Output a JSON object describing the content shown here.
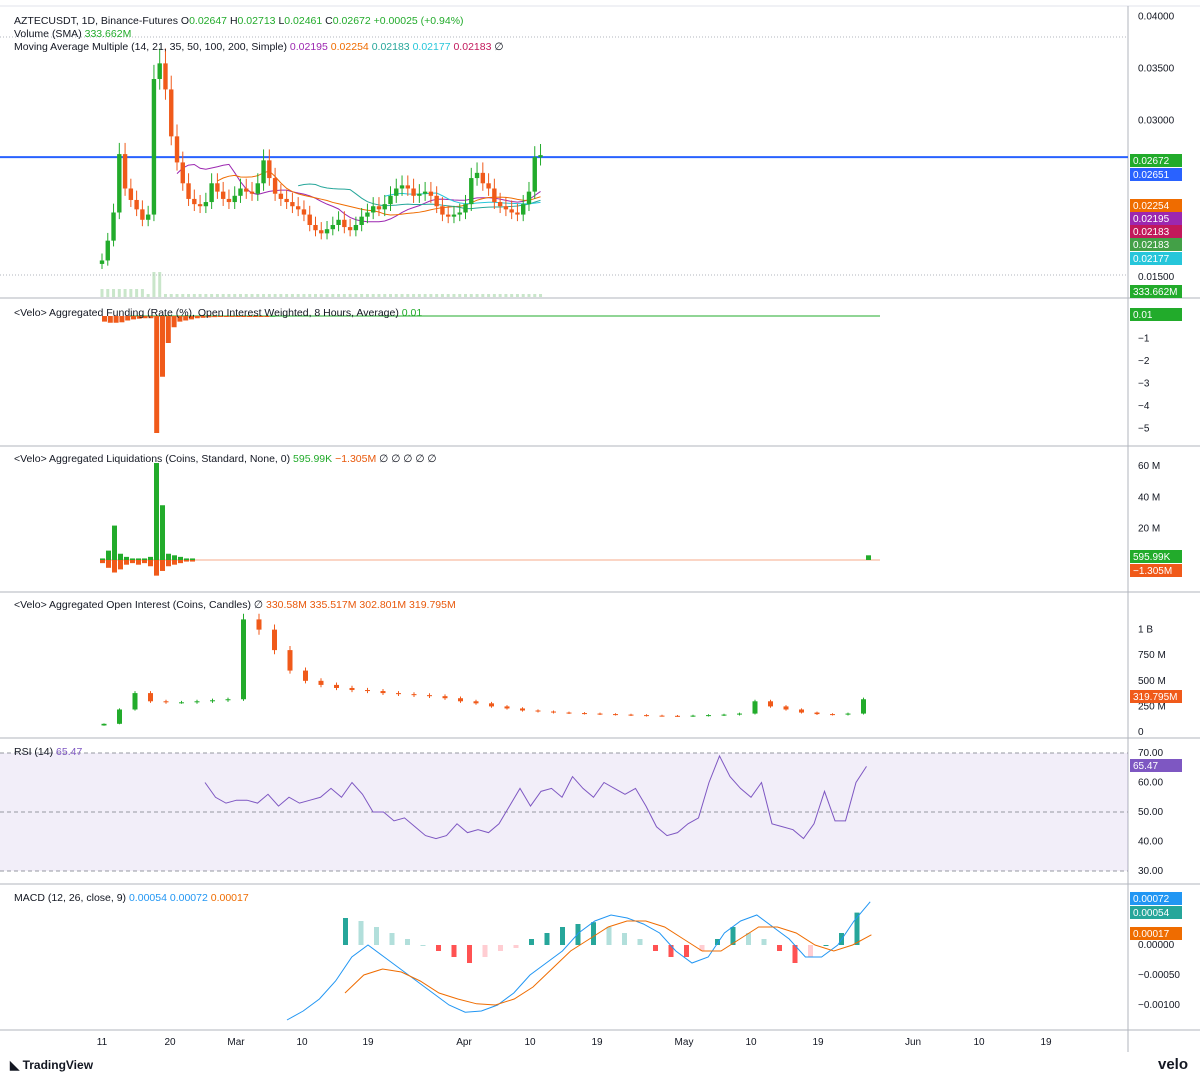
{
  "header": {
    "symbol": "AZTECUSDT, 1D, Binance-Futures",
    "o_label": "O",
    "o": "0.02647",
    "h_label": "H",
    "h": "0.02713",
    "l_label": "L",
    "l": "0.02461",
    "c_label": "C",
    "c": "0.02672",
    "change": "+0.00025 (+0.94%)"
  },
  "volume": {
    "label": "Volume (SMA)",
    "value": "333.662M"
  },
  "ma": {
    "label": "Moving Average Multiple (14, 21, 35, 50, 100, 200, Simple)",
    "v1": "0.02195",
    "v2": "0.02254",
    "v3": "0.02183",
    "v4": "0.02177",
    "v5": "0.02183",
    "null": "∅"
  },
  "funding": {
    "label": "<Velo> Aggregated Funding (Rate (%), Open Interest Weighted, 8 Hours, Average)",
    "value": "0.01"
  },
  "liquidations": {
    "label": "<Velo> Aggregated Liquidations (Coins, Standard, None, 0)",
    "v1": "595.99K",
    "v2": "−1.305M",
    "nulls": "∅ ∅ ∅ ∅ ∅"
  },
  "oi": {
    "label": "<Velo> Aggregated Open Interest (Coins, Candles)",
    "null": "∅",
    "v1": "330.58M",
    "v2": "335.517M",
    "v3": "302.801M",
    "v4": "319.795M"
  },
  "rsi": {
    "label": "RSI (14)",
    "value": "65.47"
  },
  "macd": {
    "label": "MACD (12, 26, close, 9)",
    "v1": "0.00054",
    "v2": "0.00072",
    "v3": "0.00017"
  },
  "branding": {
    "tradingview": "TradingView",
    "velo": "velo"
  },
  "colors": {
    "up": "#22ab2b",
    "down": "#f05a1a",
    "hline": "#2962ff",
    "rsi": "#7e57c2",
    "macd": "#2196f3",
    "signal": "#ef6c00"
  },
  "chart_data": [
    {
      "type": "candlestick",
      "title": "AZTECUSDT, 1D, Binance-Futures",
      "x_ticks": [
        "11",
        "20",
        "Mar",
        "10",
        "19",
        "Apr",
        "10",
        "19",
        "May",
        "10",
        "19",
        "Jun",
        "10",
        "19"
      ],
      "y_ticks": [
        "0.04000",
        "0.03500",
        "0.03000",
        "0.01500"
      ],
      "ylim": [
        0.013,
        0.041
      ],
      "horizontal_line": 0.02651,
      "price_labels": [
        "0.02672",
        "0.02651",
        "0.02254",
        "0.02195",
        "0.02183",
        "0.02183",
        "0.02177",
        "333.662M"
      ],
      "ohlc_close_series": [
        0.0166,
        0.0185,
        0.0212,
        0.0268,
        0.0235,
        0.0224,
        0.0215,
        0.0205,
        0.021,
        0.034,
        0.0355,
        0.033,
        0.0285,
        0.026,
        0.024,
        0.0225,
        0.022,
        0.0218,
        0.0222,
        0.024,
        0.0232,
        0.0225,
        0.0222,
        0.0228,
        0.0235,
        0.0232,
        0.023,
        0.024,
        0.0262,
        0.0245,
        0.023,
        0.0225,
        0.0222,
        0.0218,
        0.0215,
        0.021,
        0.02,
        0.0195,
        0.0192,
        0.0196,
        0.02,
        0.0205,
        0.0198,
        0.0195,
        0.02,
        0.0208,
        0.0212,
        0.0218,
        0.0215,
        0.022,
        0.0228,
        0.0235,
        0.0238,
        0.0235,
        0.0228,
        0.023,
        0.0232,
        0.0228,
        0.0218,
        0.021,
        0.0208,
        0.021,
        0.0212,
        0.022,
        0.0245,
        0.025,
        0.024,
        0.0235,
        0.0222,
        0.0218,
        0.0215,
        0.0212,
        0.021,
        0.022,
        0.0232,
        0.0265,
        0.0267
      ]
    },
    {
      "type": "bar",
      "title": "<Velo> Aggregated Funding (Rate (%), Open Interest Weighted, 8 Hours, Average)",
      "y_ticks": [
        "−1",
        "−2",
        "−3",
        "−4",
        "−5"
      ],
      "ylim": [
        -5.2,
        0.3
      ],
      "values": [
        -0.25,
        -0.3,
        -0.3,
        -0.28,
        -0.2,
        -0.15,
        -0.12,
        -0.1,
        -0.1,
        -5.2,
        -2.7,
        -1.2,
        -0.5,
        -0.25,
        -0.2,
        -0.15,
        -0.1,
        -0.08,
        -0.06,
        -0.05,
        -0.04,
        -0.04,
        -0.03,
        -0.03,
        -0.02,
        -0.02,
        -0.02,
        -0.01,
        -0.01,
        0.01
      ],
      "last_value": "0.01"
    },
    {
      "type": "bar",
      "title": "<Velo> Aggregated Liquidations (Coins, Standard, None, 0)",
      "y_ticks": [
        "60 M",
        "40 M",
        "20 M"
      ],
      "ylim": [
        -12,
        65
      ],
      "long_liq_values": [
        1,
        6,
        22,
        4,
        2,
        1,
        1,
        1,
        2,
        62,
        35,
        4,
        3,
        2,
        1,
        1
      ],
      "short_liq_values": [
        -2,
        -5,
        -8,
        -6,
        -3,
        -2,
        -3,
        -2,
        -4,
        -10,
        -7,
        -4,
        -3,
        -2,
        -1,
        -1
      ],
      "last_values": [
        "595.99K",
        "−1.305M"
      ]
    },
    {
      "type": "candlestick",
      "title": "<Velo> Aggregated Open Interest (Coins, Candles)",
      "y_ticks": [
        "1 B",
        "750 M",
        "500 M",
        "250 M",
        "0"
      ],
      "ylim": [
        0,
        1270
      ],
      "close_series": [
        80,
        220,
        380,
        300,
        290,
        290,
        300,
        310,
        320,
        1100,
        1000,
        800,
        600,
        500,
        460,
        430,
        410,
        400,
        380,
        370,
        360,
        350,
        330,
        300,
        280,
        250,
        230,
        210,
        200,
        190,
        185,
        180,
        175,
        170,
        165,
        160,
        158,
        156,
        160,
        165,
        170,
        180,
        300,
        250,
        220,
        190,
        175,
        170,
        180,
        320
      ],
      "last_value": "319.795M"
    },
    {
      "type": "line",
      "title": "RSI (14)",
      "y_ticks": [
        "70.00",
        "60.00",
        "50.00",
        "40.00",
        "30.00"
      ],
      "ylim": [
        25,
        75
      ],
      "bands": [
        30,
        50,
        70
      ],
      "values": [
        60,
        55,
        53,
        54,
        54,
        53,
        56,
        52,
        55,
        53,
        54,
        55,
        58,
        55,
        60,
        56,
        50,
        50,
        47,
        48,
        45,
        42,
        41,
        42,
        46,
        43,
        44,
        43,
        46,
        52,
        58,
        52,
        57,
        58,
        55,
        62,
        58,
        55,
        60,
        58,
        56,
        58,
        52,
        45,
        42,
        43,
        46,
        48,
        60,
        69,
        62,
        58,
        55,
        60,
        46,
        45,
        44,
        41,
        46,
        57,
        47,
        47,
        60,
        65.47
      ],
      "last_value": "65.47"
    },
    {
      "type": "line",
      "title": "MACD (12, 26, close, 9)",
      "y_ticks": [
        "0.00050",
        "0.00000",
        "−0.00050",
        "−0.00100"
      ],
      "ylim": [
        -0.0012,
        0.0008
      ],
      "macd_series": [
        -0.00125,
        -0.0011,
        -0.0009,
        -0.0006,
        -0.0002,
        0.0,
        -0.0002,
        -0.0004,
        -0.0006,
        -0.0008,
        -0.001,
        -0.00112,
        -0.0011,
        -0.001,
        -0.0008,
        -0.0005,
        -0.0003,
        -0.0001,
        0.0002,
        0.0004,
        0.0005,
        0.00045,
        0.00035,
        0.0002,
        -0.0001,
        -0.0003,
        -0.0002,
        0.0002,
        0.0004,
        0.0005,
        0.0003,
        0.0001,
        -0.0002,
        -0.0002,
        0.0,
        0.0004,
        0.00072
      ],
      "signal_series": [
        -0.0008,
        -0.0005,
        -0.0004,
        -0.00045,
        -0.0006,
        -0.0008,
        -0.0009,
        -0.00098,
        -0.001,
        -0.0009,
        -0.0007,
        -0.0004,
        -0.0001,
        0.0001,
        0.0003,
        0.0004,
        0.0004,
        0.0003,
        0.0001,
        -0.0001,
        -0.0001,
        0.0001,
        0.0003,
        0.0003,
        0.0002,
        0.0,
        -0.0001,
        0.0,
        0.00017
      ],
      "histogram": [
        0.00045,
        0.0004,
        0.0003,
        0.0002,
        0.0001,
        0.0,
        -0.0001,
        -0.0002,
        -0.0003,
        -0.0002,
        -0.0001,
        -5e-05,
        0.0001,
        0.0002,
        0.0003,
        0.00035,
        0.00038,
        0.0003,
        0.0002,
        0.0001,
        -0.0001,
        -0.0002,
        -0.0002,
        -0.0001,
        0.0001,
        0.0003,
        0.0002,
        0.0001,
        -0.0001,
        -0.0003,
        -0.0002,
        0.0,
        0.0002,
        0.00054
      ],
      "last_values": [
        "0.00072",
        "0.00054",
        "0.00017"
      ]
    }
  ]
}
